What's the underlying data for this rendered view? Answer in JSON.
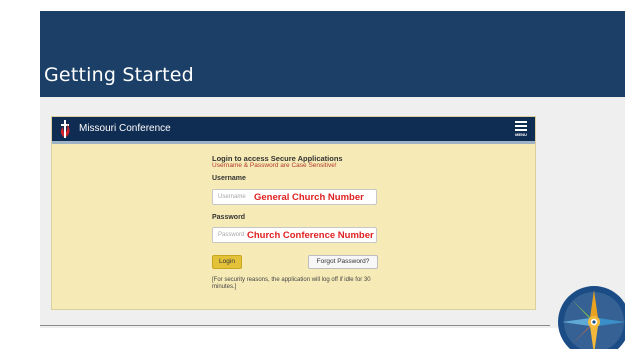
{
  "slide": {
    "title": "Getting Started",
    "colors": {
      "header": "#1b3f66",
      "body": "#efefef"
    }
  },
  "app": {
    "name": "Missouri Conference",
    "menu_label": "MENU",
    "colors": {
      "bar": "#0f2c52",
      "panel": "#f6ebb7",
      "accent_button": "#e3c23a"
    },
    "login": {
      "heading": "Login to access Secure Applications",
      "warning": "Username & Password are Case Sensitive!",
      "username_label": "Username",
      "username_placeholder": "Username",
      "username_note": "General Church Number",
      "password_label": "Password",
      "password_placeholder": "Password",
      "password_note": "Church Conference Number",
      "login_button": "Login",
      "forgot_button": "Forgot Password?",
      "security_note": "[For security reasons, the application will log off if idle for 30 minutes.]"
    }
  },
  "icons": {
    "logo": "cross-and-flame-icon",
    "menu": "hamburger-menu-icon",
    "compass": "compass-rose-icon"
  }
}
